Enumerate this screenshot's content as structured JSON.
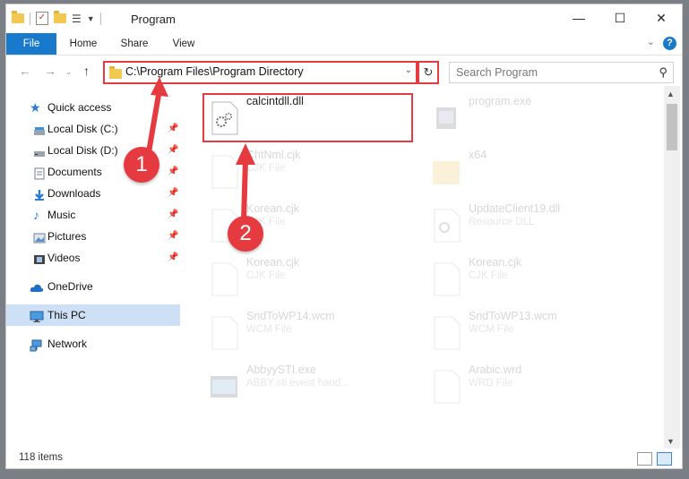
{
  "window": {
    "title": "Program",
    "controls": [
      "—",
      "☐",
      "✕"
    ]
  },
  "ribbon": {
    "tabs": [
      "File",
      "Home",
      "Share",
      "View"
    ]
  },
  "nav": {
    "address": "C:\\Program Files\\Program Directory",
    "search_placeholder": "Search Program"
  },
  "sidebar": {
    "items": [
      {
        "label": "Quick access",
        "icon": "star-icon"
      },
      {
        "label": "Local Disk (C:)",
        "icon": "drive-icon",
        "pinned": true
      },
      {
        "label": "Local Disk (D:)",
        "icon": "drive-icon",
        "pinned": true
      },
      {
        "label": "Documents",
        "icon": "documents-icon",
        "pinned": true
      },
      {
        "label": "Downloads",
        "icon": "download-icon",
        "pinned": true
      },
      {
        "label": "Music",
        "icon": "music-icon",
        "pinned": true
      },
      {
        "label": "Pictures",
        "icon": "pictures-icon",
        "pinned": true
      },
      {
        "label": "Videos",
        "icon": "videos-icon",
        "pinned": true
      },
      {
        "label": "OneDrive",
        "icon": "cloud-icon"
      },
      {
        "label": "This PC",
        "icon": "computer-icon",
        "selected": true
      },
      {
        "label": "Network",
        "icon": "network-icon"
      }
    ]
  },
  "files": [
    {
      "name": "calcintdll.dll",
      "type": "",
      "icon": "dll-icon",
      "highlighted": true
    },
    {
      "name": "program.exe",
      "type": "",
      "icon": "exe-icon"
    },
    {
      "name": "ChtNml.cjk",
      "type": "CJK File",
      "icon": "file-icon"
    },
    {
      "name": "x64",
      "type": "",
      "icon": "folder-icon"
    },
    {
      "name": "Korean.cjk",
      "type": "CJK File",
      "icon": "file-icon"
    },
    {
      "name": "UpdateClient19.dll",
      "type": "Resource DLL",
      "icon": "dll-icon"
    },
    {
      "name": "Korean.cjk",
      "type": "CJK File",
      "icon": "file-icon"
    },
    {
      "name": "Korean.cjk",
      "type": "CJK File",
      "icon": "file-icon"
    },
    {
      "name": "SndToWP14.wcm",
      "type": "WCM File",
      "icon": "file-icon"
    },
    {
      "name": "SndToWP13.wcm",
      "type": "WCM File",
      "icon": "file-icon"
    },
    {
      "name": "AbbyySTI.exe",
      "type": "ABBY sti event hand...",
      "icon": "app-icon"
    },
    {
      "name": "Arabic.wrd",
      "type": "WRD File",
      "icon": "file-icon"
    }
  ],
  "status": {
    "count": "118 items"
  },
  "steps": [
    "1",
    "2"
  ],
  "colors": {
    "accent": "#1979ca",
    "highlight": "#e53a40",
    "selected": "#cde0f5"
  }
}
